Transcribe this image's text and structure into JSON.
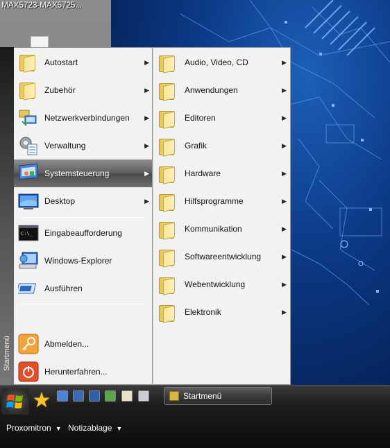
{
  "window_title": "MAX5723-MAX5725...",
  "start_menu": {
    "strip_label": "Startmenü",
    "left_items": [
      {
        "label": "Autostart",
        "arrow": "▶",
        "icon": "folder-icon"
      },
      {
        "label": "Zubehör",
        "arrow": "▶",
        "icon": "folder-icon"
      },
      {
        "label": "Netzwerkverbindungen",
        "arrow": "▶",
        "icon": "network-connections-icon"
      },
      {
        "label": "Verwaltung",
        "arrow": "▶",
        "icon": "administration-icon"
      },
      {
        "label": "Systemsteuerung",
        "arrow": "▶",
        "icon": "control-panel-icon"
      },
      {
        "label": "Desktop",
        "arrow": "▶",
        "icon": "desktop-icon"
      },
      {
        "label": "Eingabeaufforderung",
        "icon": "command-prompt-icon"
      },
      {
        "label": "Windows-Explorer",
        "icon": "windows-explorer-icon"
      },
      {
        "label": "Ausführen",
        "icon": "run-icon"
      },
      {
        "label": "Abmelden...",
        "icon": "logoff-key-icon"
      },
      {
        "label": "Herunterfahren...",
        "icon": "shutdown-icon"
      }
    ],
    "right_items": [
      {
        "label": "Audio, Video, CD",
        "arrow": "▶"
      },
      {
        "label": "Anwendungen",
        "arrow": "▶"
      },
      {
        "label": "Editoren",
        "arrow": "▶"
      },
      {
        "label": "Grafik",
        "arrow": "▶"
      },
      {
        "label": "Hardware",
        "arrow": "▶"
      },
      {
        "label": "Hilfsprogramme",
        "arrow": "▶"
      },
      {
        "label": "Kommunikation",
        "arrow": "▶"
      },
      {
        "label": "Softwareentwicklung",
        "arrow": "▶"
      },
      {
        "label": "Webentwicklung",
        "arrow": "▶"
      },
      {
        "label": "Elektronik",
        "arrow": "▶"
      }
    ]
  },
  "taskbar": {
    "task_label": "Startmenü",
    "menus": [
      {
        "label": "Proxomitron",
        "caret": "▼"
      },
      {
        "label": "Notizablage",
        "caret": "▼"
      }
    ],
    "star_glyph": "★"
  },
  "colors": {
    "highlight": "#5d5d5d",
    "wallpaper": "#0c3a86",
    "folder": "#f6e08c"
  }
}
